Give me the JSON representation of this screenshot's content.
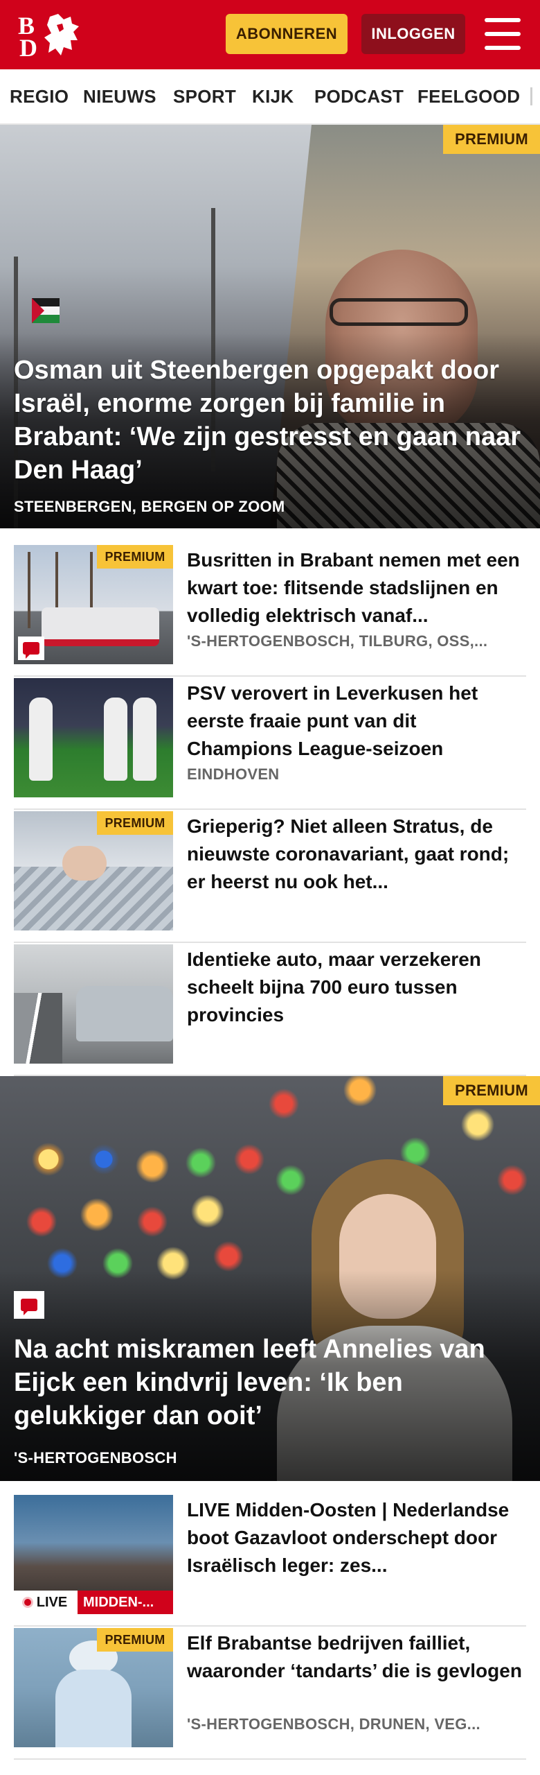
{
  "header": {
    "logo_line1": "B",
    "logo_line2": "D",
    "subscribe_label": "ABONNEREN",
    "login_label": "INLOGGEN",
    "brand_color": "#d0021b",
    "accent_color": "#f7c338"
  },
  "nav": {
    "items": [
      "REGIO",
      "NIEUWS",
      "SPORT",
      "KIJK",
      "PODCAST",
      "FEELGOOD"
    ]
  },
  "hero": {
    "badge": "PREMIUM",
    "title": "Osman uit Steenbergen opgepakt door Israël, enorme zorgen bij familie in Brabant: ‘We zijn gestresst en gaan naar Den Haag’",
    "location": "STEENBERGEN, BERGEN OP ZOOM"
  },
  "articles": [
    {
      "badge": "PREMIUM",
      "title": "Busritten in Brabant nemen met een kwart toe: flitsende stadslij­nen en volledig elektrisch vanaf...",
      "location": "'S-HERTOGENBOSCH, TILBURG, OSS,..."
    },
    {
      "title": "PSV verovert in Leverkusen het eerste fraaie punt van dit Champions League-seizoen",
      "location": "EINDHOVEN"
    },
    {
      "badge": "PREMIUM",
      "title": "Grieperig? Niet alleen Stratus, de nieuwste coronavariant, gaat rond; er heerst nu ook het...",
      "location": ""
    },
    {
      "title": "Identieke auto, maar verzekeren scheelt bijna 700 euro tussen provincies",
      "location": ""
    }
  ],
  "hero2": {
    "badge": "PREMIUM",
    "title": "Na acht miskramen leeft Annelies van Eijck een kindvrij leven: ‘Ik ben gelukkiger dan ooit’",
    "location": "'S-HERTOGENBOSCH"
  },
  "articles2": [
    {
      "live_label": "LIVE",
      "topic_label": "MIDDEN-...",
      "title": "LIVE Midden-Oosten | Nederland­se boot Gazavloot onderschept door Israëlisch leger: zes...",
      "location": ""
    },
    {
      "badge": "PREMIUM",
      "title": "Elf Brabantse bedrijven failliet, waaronder ‘tandarts’ die is gevlogen",
      "location": "'S-HERTOGENBOSCH, DRUNEN, VEG..."
    }
  ]
}
